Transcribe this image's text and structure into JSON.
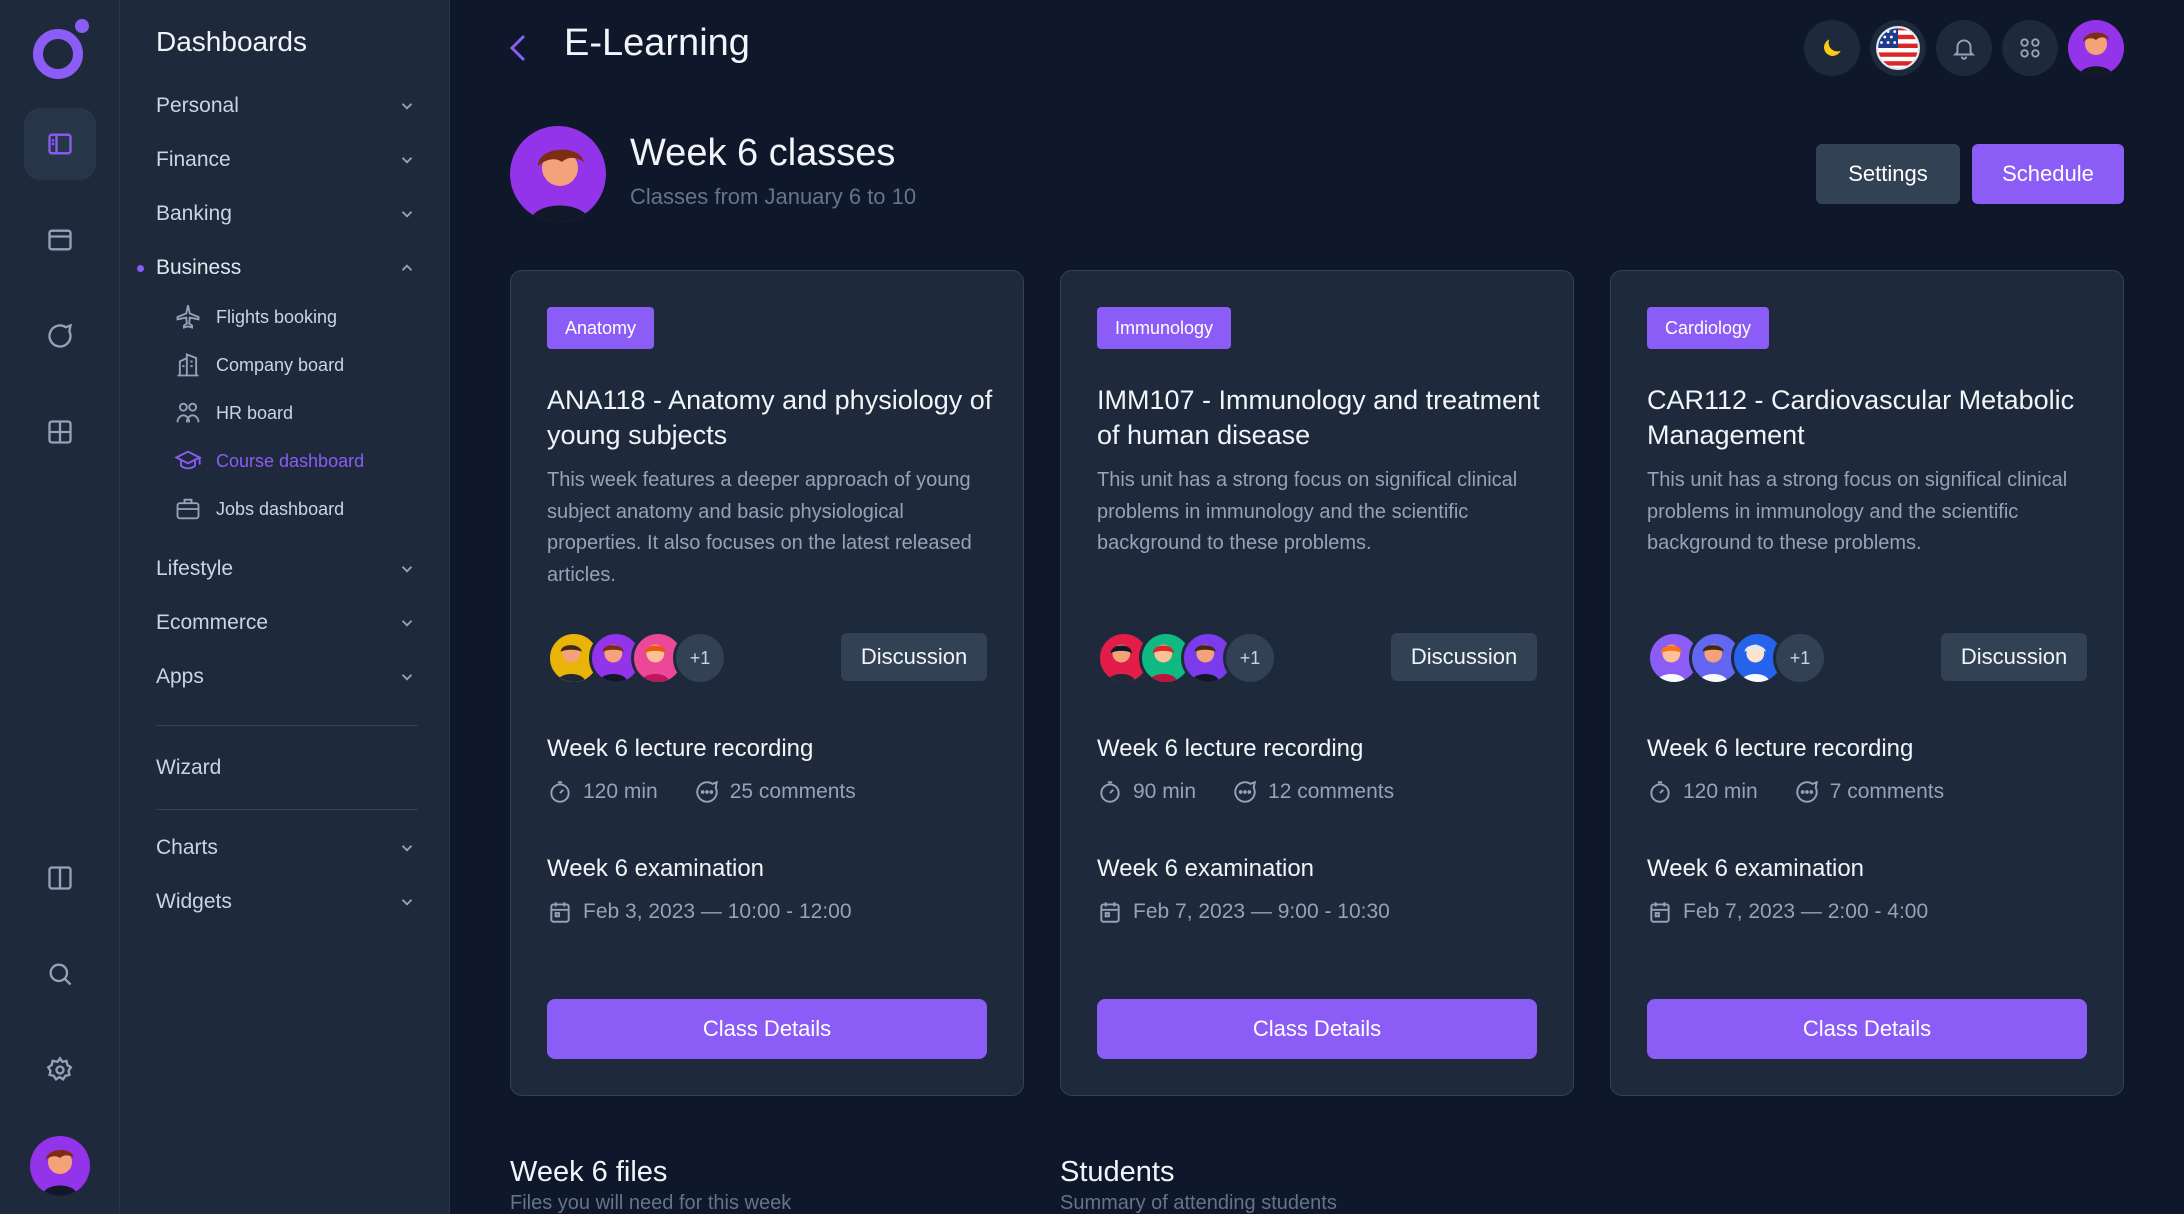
{
  "app": {
    "accent": "#8b5cf6",
    "background": "#0f172a",
    "panel": "#1e293b"
  },
  "menu": {
    "title": "Dashboards",
    "items": [
      {
        "label": "Personal"
      },
      {
        "label": "Finance"
      },
      {
        "label": "Banking"
      },
      {
        "label": "Business"
      },
      {
        "label": "Lifestyle"
      },
      {
        "label": "Ecommerce"
      },
      {
        "label": "Apps"
      },
      {
        "label": "Wizard"
      },
      {
        "label": "Charts"
      },
      {
        "label": "Widgets"
      }
    ],
    "business_sub": [
      {
        "label": "Flights booking",
        "icon": "airplane-icon"
      },
      {
        "label": "Company board",
        "icon": "building-icon"
      },
      {
        "label": "HR board",
        "icon": "users-icon"
      },
      {
        "label": "Course dashboard",
        "icon": "graduation-cap-icon"
      },
      {
        "label": "Jobs dashboard",
        "icon": "briefcase-icon"
      }
    ]
  },
  "header": {
    "title": "E-Learning"
  },
  "hero": {
    "title": "Week 6 classes",
    "subtitle": "Classes from January 6 to 10",
    "settings_label": "Settings",
    "schedule_label": "Schedule"
  },
  "cards": [
    {
      "tag": "Anatomy",
      "title": "ANA118 - Anatomy and physiology of young subjects",
      "description": "This week features a deeper approach of young subject anatomy and basic physiological properties. It also focuses on the latest released articles.",
      "more": "+1",
      "discussion_label": "Discussion",
      "recording_title": "Week 6 lecture recording",
      "duration": "120 min",
      "comments": "25 comments",
      "exam_title": "Week 6 examination",
      "exam_date": "Feb 3, 2023 — 10:00 - 12:00",
      "button_label": "Class Details"
    },
    {
      "tag": "Immunology",
      "title": "IMM107 - Immunology and treatment of human disease",
      "description": "This unit has a strong focus on significal clinical problems in immunology and the scientific background to these problems.",
      "more": "+1",
      "discussion_label": "Discussion",
      "recording_title": "Week 6 lecture recording",
      "duration": "90 min",
      "comments": "12 comments",
      "exam_title": "Week 6 examination",
      "exam_date": "Feb 7, 2023 — 9:00 - 10:30",
      "button_label": "Class Details"
    },
    {
      "tag": "Cardiology",
      "title": "CAR112 - Cardiovascular Metabolic Management",
      "description": "This unit has a strong focus on significal clinical problems in immunology and the scientific background to these problems.",
      "more": "+1",
      "discussion_label": "Discussion",
      "recording_title": "Week 6 lecture recording",
      "duration": "120 min",
      "comments": "7 comments",
      "exam_title": "Week 6 examination",
      "exam_date": "Feb 7, 2023 — 2:00 - 4:00",
      "button_label": "Class Details"
    }
  ],
  "bottom": {
    "files_title": "Week 6 files",
    "files_sub": "Files you will need for this week",
    "students_title": "Students",
    "students_sub": "Summary of attending students"
  }
}
